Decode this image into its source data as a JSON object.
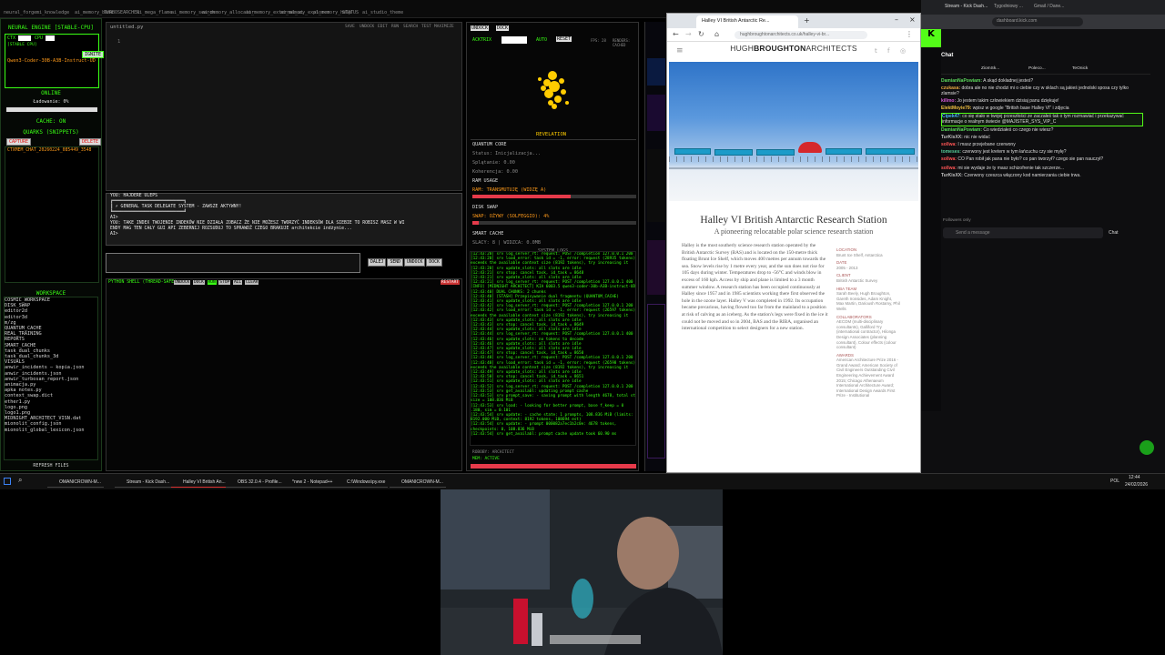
{
  "top_bookmarks": [
    "neural_forge",
    "mi_knowledge",
    "ai_memory_bank",
    "TURBOSEARCHER",
    "ai_mega_flame",
    "ai_memory_search",
    "ai_memory_allocator",
    "ai_memory_external_ai",
    "ai_memory_explorer",
    "ai_memory_help",
    "STATUS",
    "ai_studio_theme"
  ],
  "left_panel": {
    "engine_title": "NEURAL ENGINE [STABLE-CPU]",
    "ctx_label": "CTX",
    "cpu_label": "CPU",
    "stable_cpu_label": "[STABLE CPU]",
    "ignite_label": "IGNITE",
    "model_name": "Qwen3-Coder-30B-A3B-Instruct-UD-Q8",
    "status": "ONLINE",
    "loading": "Ładowanie: 0%",
    "cache_status": "CACHE: ON",
    "quarks_title": "QUARKS (SNIPPETS)",
    "capture_label": "CAPTURE",
    "delete_label": "DELETE",
    "snippet_name": "CTXMEM_CHAT_20260224_085449_3548",
    "workspace_title": "WORKSPACE",
    "workspace_items": [
      "COSMIC_WORKSPACE",
      "DISK_SWAP",
      "editor2d",
      "editor3d",
      "m/zg",
      "QUANTUM_CACHE",
      "REAL_TRAINING",
      "REPORTS",
      "SMART_CACHE",
      "task_dual_chunks",
      "task_dual_chunks_3d",
      "VISUALS",
      "anwir_incidents — kopia.json",
      "anwir_incidents.json",
      "anwir_turbosan_report.json",
      "animacja.py",
      "apka notes.py",
      "context_swap.dict",
      "ether1.py",
      "logo.png",
      "logo1.png",
      "MIDNIGHT_ARCHITECT_VISN.dat",
      "mionolit_config.json",
      "mionolit_global_lexicon.json"
    ],
    "refresh_label": "REFRESH FILES"
  },
  "editor": {
    "tab_label": "untitled.py",
    "toolbar": [
      "SAVE",
      "UNDOCK",
      "EDIT",
      "RUN",
      "SEARCH",
      "TEST",
      "MAXIMIZE"
    ],
    "line_no": "1"
  },
  "chat_output": {
    "lines": [
      "YOU: HAJDERE ULEPS",
      "            ╔═══════════════════════════╗",
      "            ║ ⚡ GENERAL TASK DELEGATE SYSTEM - ZAWSZE AKTYWNY!",
      "            ╚═══════════════════════════╝",
      "AI>",
      "YOU: TAKE INDEX TWOJENIE INDEKÓW NIE DZIAŁA ZOBACZ ŻE NIE MOŻESZ TWORZYĆ INDEKSÓW DLA SIEBIE TO ROBISZ MASZ W WI",
      "ENDY MAG TEN CAŁY GUI API ZEBERNIJ ROZSUDUJ TO SPRAWDŹ CZEGO BRAKUJE architekcie indżynie...",
      "AI>"
    ]
  },
  "command_buttons": [
    "DALEJ",
    "SEND",
    "UNDOCK",
    "DOCK"
  ],
  "pyshell": {
    "title": "PYTHON SHELL (THREAD-SAFE)",
    "buttons": [
      "UNDOCK",
      "DOCK",
      "RUN",
      "STOP",
      "ALL",
      "CLEAR"
    ],
    "restart": "RESTART"
  },
  "quantum": {
    "undock": "UNDOCK",
    "dock": "DOCK",
    "acktrix": "ACKTRIX",
    "auto": "AUTO",
    "reset": "RESET",
    "fps": "FPS: 28",
    "info": "RENDERS: CACHED",
    "revelation": "REVELATION",
    "core_title": "QUANTUM CORE",
    "status": "Status: Inicjalizacja...",
    "splatanie": "Splątanie: 0.00",
    "koherencja": "Koherencja: 0.00",
    "ram_title": "RAM USAGE",
    "ram_value": "RAM: TRANSMUTUJĘ (WIDZĘ A)",
    "ram_fill": 0.6,
    "disk_title": "DISK SWAP",
    "disk_value": "SWAP: OŻYWY (SOLFEGGIO): 4%",
    "disk_fill": 0.04,
    "smart_title": "SMART CACHE",
    "smart_value": "SLACY: 8 | WIDZCA: 0.0MB",
    "logs_title": "SYSTEM LOGS",
    "log_lines": [
      "[12:43:20] srv  log_server_rt: request: POST /completion 127.0.0.1 200",
      "[12:43:20] srv  load_error: task id = -1, error: request (28935 tokens)",
      "  exceeds the available context size (8192 tokens), try increasing it",
      "[12:43:20] srv  update_slots: all slots are idle",
      "[12:43:21] srv  stop: cancel task, id_task = 8648",
      "[12:43:21] srv  update_slots: all slots are idle",
      "[12:43:21] srv  log_server_rt: request: POST /completion 127.0.0.1 400",
      "[INFO] [MIDNIGHT ARCHITECT] KIA 6003.5 qwen3-coder-30b-A3B-instruct-UD-Q8",
      "[12:43:40] DUAL CHUNKS: 2 chunks",
      "[12:43:40] [STASH] Przepisywanie dual fragmentu (QUANTUM_CACHE)",
      "[12:43:41] srv  update_slots: all slots are idle",
      "[12:43:42] srv  log_server_rt: request: POST /completion 127.0.0.1 200",
      "[12:43:42] srv  load_error: task id = -1, error: request (26597 tokens)",
      "  exceeds the available context size (8192 tokens), try increasing it",
      "[12:43:43] srv  update_slots: all slots are idle",
      "[12:43:43] srv  stop: cancel task, id_task = 8649",
      "[12:43:44] srv  update_slots: all slots are idle",
      "[12:43:44] srv  log_server_rt: request: POST /completion 127.0.0.1 400",
      "[12:43:46] srv  update_slots: no tokens to decode",
      "[12:43:46] srv  update_slots: all slots are idle",
      "[12:43:47] srv  update_slots: all slots are idle",
      "[12:43:47] srv  stop: cancel task, id_task = 8650",
      "[12:43:48] srv  log_server_rt: request: POST /completion 127.0.0.1 200",
      "[12:43:48] srv  load_error: task id = -1, error: request (26598 tokens)",
      "  exceeds the available context size (8192 tokens), try increasing it",
      "[12:43:49] srv  update_slots: all slots are idle",
      "[12:43:50] srv  stop: cancel task, id_task = 8651",
      "[12:43:51] srv  update_slots: all slots are idle",
      "[12:43:52] srv  log_server_rt: request: POST /completion 127.0.0.1 200",
      "[12:43:53] srv  get_availabl: updating prompt cache",
      "[12:43:53] srv  prompt_save: - saving prompt with length 4678, total state",
      "  size = 108.836 MiB",
      "[12:43:53] srv       load: - looking for better prompt, base f_keep = 0",
      "  .180, sim = 0.101",
      "[12:43:54] srv    update: - cache state: 1 prompts, 108.836 MiB (limits:",
      "  8192.000 MiB, context: 8192 tokens, 108694 est)",
      "[12:43:54] srv    update:  - prompt 000082a7ec1b2c0e:  4678 tokens,",
      "  checkpoints: 0,  108.836 MiB",
      "[12:43:54] srv  get_availabl: prompt cache update took 60.90 ms"
    ],
    "footer": "ROBOBY: ARCHITECT",
    "footer2": "MEM: ACTIVE"
  },
  "browser": {
    "tab_title": "Halley VI British Antarctic Re...",
    "url": "hughbroughtonarchitects.co.uk/halley-vi-br...",
    "site_name_light": "HUGH",
    "site_name_bold": "BROUGHTON",
    "site_name_tail": "ARCHITECTS",
    "title": "Halley VI British Antarctic Research Station",
    "subtitle": "A pioneering relocatable polar science research station",
    "body": "Halley is the most southerly science research station operated by the British Antarctic Survey (BAS) and is located on the 150-metre thick floating Brunt Ice Shelf, which moves 400 metres per annum towards the sea. Snow levels rise by 1 metre every year, and the sun does not rise for 105 days during winter. Temperatures drop to -56°C and winds blow in excess of 160 kph. Access by ship and plane is limited to a 3 month summer window. A research station has been occupied continuously at Halley since 1957 and in 1985 scientists working there first observed the hole in the ozone layer. Halley V was completed in 1992. Its occupation became precarious, having flowed too far from the mainland to a position at risk of calving as an iceberg. As the station's legs were fixed in the ice it could not be moved and so in 2004, BAS and the RIBA, organised an international competition to select designers for a new station.",
    "side": [
      {
        "k": "Location",
        "v": "Brunt Ice Shelf, Antarctica"
      },
      {
        "k": "Date",
        "v": "2005 - 2013"
      },
      {
        "k": "Client",
        "v": "British Antarctic Survey"
      },
      {
        "k": "HBA Team",
        "v": "Sarah Beely, Hugh Broughton, Gareth Ironsides, Adam Knight, Max Martin, Darioush Rostamy, Phil Wells"
      },
      {
        "k": "Collaborators",
        "v": "AECOM (multi-disciplinary consultants), Galliford Try (international contractor), Hilonga Design Associates (planning consultant), Colour effects (colour consultant)"
      },
      {
        "k": "Awards",
        "v": "American Architecture Prize 2016 - Grand Award; American Society of Civil Engineers Outstanding Civil Engineering Achievement Award 2015; Chicago Athenaeum International Architecture Award; International Design Awards First Prize - Institutional"
      }
    ]
  },
  "twitch": {
    "tab1": "Stream - Kick Dash...",
    "tab2": "Tygodniowy ...",
    "tab3": "Gmail / Dane...",
    "url": "dashboard.kick.com",
    "chat_title": "Chat",
    "pinned": [
      "ZiomSk...",
      "Poleco...",
      "TeOnick"
    ],
    "messages": [
      {
        "user": "DamianNaPowiam:",
        "text": "A skąd dokładnej jesteś?",
        "color": "#5bd65b"
      },
      {
        "user": "czukasa:",
        "text": "dobra ale no nie chodzi mi o ciebie czy w sklach są jakieś jednolski sposa czy tylko zlamsie?",
        "color": "#e6a640"
      },
      {
        "user": "killmo:",
        "text": "Jo jestem takim człowiekiem dzisiaj panu dziękuje!",
        "color": "#d85ad8"
      },
      {
        "user": "ElektMoyie79:",
        "text": "wpisz w google \"British base Halley VI\" i zdjęcia",
        "color": "#f0c040"
      },
      {
        "user": "Cipek47:",
        "text": "co się stało w twojej przeszłości ze zaczałeś tak o tym rozmawiać i przekazywać informacje o realnym świecie @MAJISTER_SYS_VIP_C",
        "color": "#4db4ff"
      },
      {
        "user": "DamianNaPowiam:",
        "text": "Co wiedziałeś co czego nie wiesz?",
        "color": "#5bd65b"
      },
      {
        "user": "TurKisXX:",
        "text": "nic nie widać",
        "color": "#c0c0c0"
      },
      {
        "user": "sollwa:",
        "text": "I masz przejebane czerwony",
        "color": "#ff5555"
      },
      {
        "user": "tomeses:",
        "text": "czerwony jest kretem w tym łańcuchu czy sie mylę?",
        "color": "#55cc99"
      },
      {
        "user": "sollwa:",
        "text": "CO Pan robił jak pana nie było? co pan tworzył? czego sie pan nauczył?",
        "color": "#ff5555"
      },
      {
        "user": "sollwa:",
        "text": "mi sie wydaje że ty masz schizofrenie tak szczerze...",
        "color": "#ff5555"
      },
      {
        "user": "TurKisXX:",
        "text": "Czerwony czeszca włączony kod namierzania ciebie trwa.",
        "color": "#c0c0c0"
      }
    ],
    "followers_only": "Followers only",
    "send_placeholder": "Send a message",
    "chat_button": "Chat"
  },
  "taskbar": {
    "items": [
      "OMANICROWN-M...",
      "Stream - Kick Dash...",
      "Halley VI British An...",
      "OBS 32.0.4 - Profile...",
      "*new 2 - Notepad++",
      "C:\\Windows\\py.exe",
      "OMANICROWN-M..."
    ],
    "time": "12:44",
    "date": "24/02/2026",
    "lang": "POL"
  }
}
